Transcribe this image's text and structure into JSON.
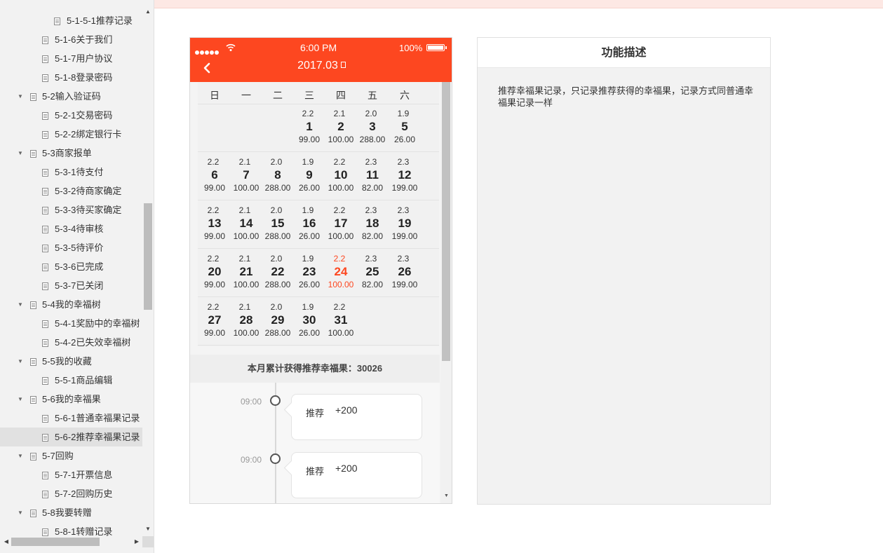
{
  "sidebar": {
    "items": [
      {
        "label": "5-1-5-1推荐记录",
        "level": 3,
        "expanded": null
      },
      {
        "label": "5-1-6关于我们",
        "level": 2,
        "expanded": null
      },
      {
        "label": "5-1-7用户协议",
        "level": 2,
        "expanded": null
      },
      {
        "label": "5-1-8登录密码",
        "level": 2,
        "expanded": null
      },
      {
        "label": "5-2输入验证码",
        "level": 1,
        "expanded": true
      },
      {
        "label": "5-2-1交易密码",
        "level": 2,
        "expanded": null
      },
      {
        "label": "5-2-2绑定银行卡",
        "level": 2,
        "expanded": null
      },
      {
        "label": "5-3商家报单",
        "level": 1,
        "expanded": true
      },
      {
        "label": "5-3-1待支付",
        "level": 2,
        "expanded": null
      },
      {
        "label": "5-3-2待商家确定",
        "level": 2,
        "expanded": null
      },
      {
        "label": "5-3-3待买家确定",
        "level": 2,
        "expanded": null
      },
      {
        "label": "5-3-4待审核",
        "level": 2,
        "expanded": null
      },
      {
        "label": "5-3-5待评价",
        "level": 2,
        "expanded": null
      },
      {
        "label": "5-3-6已完成",
        "level": 2,
        "expanded": null
      },
      {
        "label": "5-3-7已关闭",
        "level": 2,
        "expanded": null
      },
      {
        "label": "5-4我的幸福树",
        "level": 1,
        "expanded": true
      },
      {
        "label": "5-4-1奖励中的幸福树",
        "level": 2,
        "expanded": null
      },
      {
        "label": "5-4-2已失效幸福树",
        "level": 2,
        "expanded": null
      },
      {
        "label": "5-5我的收藏",
        "level": 1,
        "expanded": true
      },
      {
        "label": "5-5-1商品编辑",
        "level": 2,
        "expanded": null
      },
      {
        "label": "5-6我的幸福果",
        "level": 1,
        "expanded": true
      },
      {
        "label": "5-6-1普通幸福果记录",
        "level": 2,
        "expanded": null
      },
      {
        "label": "5-6-2推荐幸福果记录",
        "level": 2,
        "expanded": null,
        "selected": true
      },
      {
        "label": "5-7回购",
        "level": 1,
        "expanded": true
      },
      {
        "label": "5-7-1开票信息",
        "level": 2,
        "expanded": null
      },
      {
        "label": "5-7-2回购历史",
        "level": 2,
        "expanded": null
      },
      {
        "label": "5-8我要转赠",
        "level": 1,
        "expanded": true
      },
      {
        "label": "5-8-1转赠记录",
        "level": 2,
        "expanded": null
      }
    ]
  },
  "phone": {
    "status": {
      "time": "6:00 PM",
      "battery": "100%"
    },
    "title": "2017.03",
    "weekdays": [
      "日",
      "一",
      "二",
      "三",
      "四",
      "五",
      "六"
    ],
    "weeks": [
      [
        null,
        null,
        null,
        {
          "rate": "2.2",
          "day": "1",
          "amount": "99.00"
        },
        {
          "rate": "2.1",
          "day": "2",
          "amount": "100.00"
        },
        {
          "rate": "2.0",
          "day": "3",
          "amount": "288.00"
        },
        {
          "rate": "1.9",
          "day": "5",
          "amount": "26.00"
        }
      ],
      [
        {
          "rate": "2.2",
          "day": "6",
          "amount": "99.00"
        },
        {
          "rate": "2.1",
          "day": "7",
          "amount": "100.00"
        },
        {
          "rate": "2.0",
          "day": "8",
          "amount": "288.00"
        },
        {
          "rate": "1.9",
          "day": "9",
          "amount": "26.00"
        },
        {
          "rate": "2.2",
          "day": "10",
          "amount": "100.00"
        },
        {
          "rate": "2.3",
          "day": "11",
          "amount": "82.00"
        },
        {
          "rate": "2.3",
          "day": "12",
          "amount": "199.00"
        }
      ],
      [
        {
          "rate": "2.2",
          "day": "13",
          "amount": "99.00"
        },
        {
          "rate": "2.1",
          "day": "14",
          "amount": "100.00"
        },
        {
          "rate": "2.0",
          "day": "15",
          "amount": "288.00"
        },
        {
          "rate": "1.9",
          "day": "16",
          "amount": "26.00"
        },
        {
          "rate": "2.2",
          "day": "17",
          "amount": "100.00"
        },
        {
          "rate": "2.3",
          "day": "18",
          "amount": "82.00"
        },
        {
          "rate": "2.3",
          "day": "19",
          "amount": "199.00"
        }
      ],
      [
        {
          "rate": "2.2",
          "day": "20",
          "amount": "99.00"
        },
        {
          "rate": "2.1",
          "day": "21",
          "amount": "100.00"
        },
        {
          "rate": "2.0",
          "day": "22",
          "amount": "288.00"
        },
        {
          "rate": "1.9",
          "day": "23",
          "amount": "26.00"
        },
        {
          "rate": "2.2",
          "day": "24",
          "amount": "100.00",
          "today": true
        },
        {
          "rate": "2.3",
          "day": "25",
          "amount": "82.00"
        },
        {
          "rate": "2.3",
          "day": "26",
          "amount": "199.00"
        }
      ],
      [
        {
          "rate": "2.2",
          "day": "27",
          "amount": "99.00"
        },
        {
          "rate": "2.1",
          "day": "28",
          "amount": "100.00"
        },
        {
          "rate": "2.0",
          "day": "29",
          "amount": "288.00"
        },
        {
          "rate": "1.9",
          "day": "30",
          "amount": "26.00"
        },
        {
          "rate": "2.2",
          "day": "31",
          "amount": "100.00"
        },
        null,
        null
      ]
    ],
    "summary": "本月累计获得推荐幸福果：30026",
    "timeline": [
      {
        "time": "09:00",
        "type": "推荐",
        "value": "+200"
      },
      {
        "time": "09:00",
        "type": "推荐",
        "value": "+200"
      }
    ]
  },
  "description": {
    "title": "功能描述",
    "text": "推荐幸福果记录，只记录推荐获得的幸福果，记录方式同普通幸福果记录一样"
  },
  "colors": {
    "brand": "#fd4720",
    "today": "#fd4720"
  }
}
